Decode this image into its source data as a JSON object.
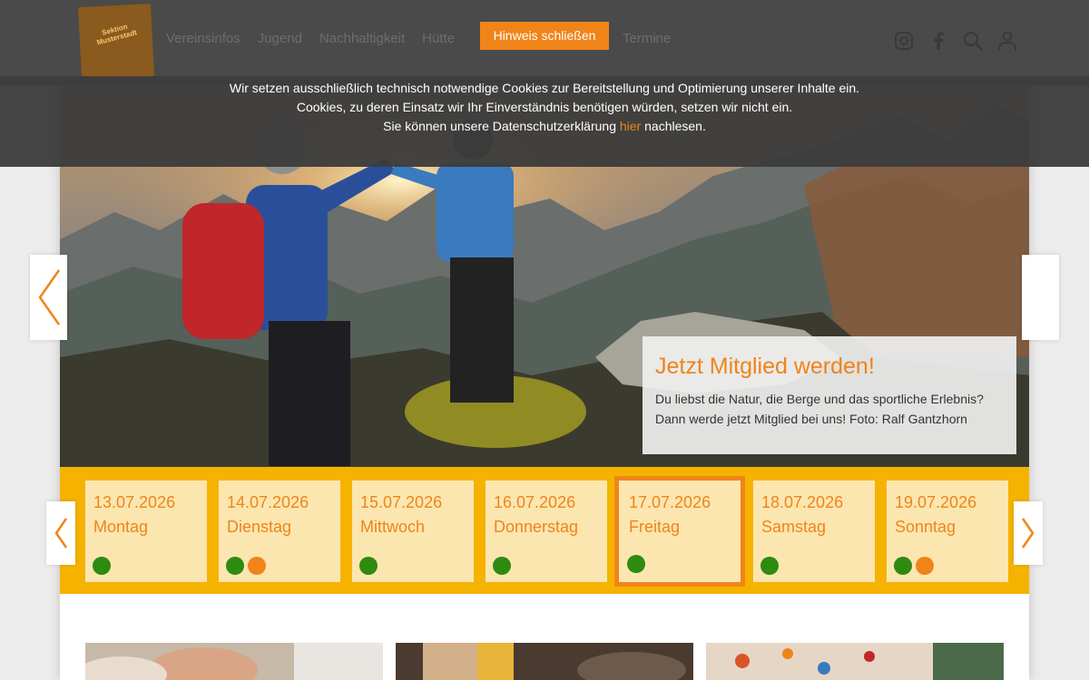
{
  "header": {
    "logo_text": "Sektion Musterstadt",
    "nav": [
      "Vereinsinfos",
      "Jugend",
      "Nachhaltigkeit",
      "Hütte"
    ],
    "nav_right": "Termine",
    "dismiss_label": "Hinweis schließen",
    "icons": [
      "instagram-icon",
      "facebook-icon",
      "search-icon",
      "user-icon"
    ]
  },
  "cookie": {
    "line1": "Wir setzen ausschließlich technisch notwendige Cookies zur Bereitstellung und Optimierung unserer Inhalte ein.",
    "line2": "Cookies, zu deren Einsatz wir Ihr Einverständnis benötigen würden, setzen wir nicht ein.",
    "line3_before": "Sie können unsere Datenschutzerklärung ",
    "line3_link": "hier",
    "line3_after": " nachlesen."
  },
  "hero": {
    "title": "Jetzt Mitglied werden!",
    "line1": "Du liebst die Natur, die Berge und das sportliche Erlebnis?",
    "line2": "Dann werde jetzt Mitglied bei uns! Foto: Ralf Gantzhorn"
  },
  "calendar": {
    "days": [
      {
        "date": "13.07.2026",
        "name": "Montag",
        "dots": [
          "green"
        ]
      },
      {
        "date": "14.07.2026",
        "name": "Dienstag",
        "dots": [
          "green",
          "orange"
        ]
      },
      {
        "date": "15.07.2026",
        "name": "Mittwoch",
        "dots": [
          "green"
        ]
      },
      {
        "date": "16.07.2026",
        "name": "Donnerstag",
        "dots": [
          "green"
        ]
      },
      {
        "date": "17.07.2026",
        "name": "Freitag",
        "dots": [
          "green"
        ],
        "active": true
      },
      {
        "date": "18.07.2026",
        "name": "Samstag",
        "dots": [
          "green"
        ]
      },
      {
        "date": "19.07.2026",
        "name": "Sonntag",
        "dots": [
          "green",
          "orange"
        ]
      }
    ]
  },
  "colors": {
    "accent": "#f08419",
    "calendar_bg": "#f5b300",
    "day_bg": "#fce6b0",
    "green": "#2e8b0f",
    "orange": "#f08419"
  }
}
